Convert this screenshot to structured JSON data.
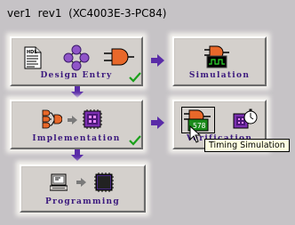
{
  "window": {
    "title": "ver1  rev1  (XC4003E-3-PC84)"
  },
  "flow": {
    "design_entry": {
      "label": "Design Entry",
      "completed": true
    },
    "simulation": {
      "label": "Simulation"
    },
    "implementation": {
      "label": "Implementation",
      "completed": true
    },
    "verification": {
      "label": "Verification"
    },
    "programming": {
      "label": "Programming"
    }
  },
  "tooltip": {
    "text": "Timing Simulation"
  },
  "icons": {
    "hdl_editor": "hdl-document-icon",
    "state_editor": "state-diagram-icon",
    "schematic": "and-gate-icon",
    "functional_sim": "logic-analyzer-icon",
    "impl_netlist": "netlist-tree-icon",
    "chip": "fpga-chip-icon",
    "timing_sim": "timing-simulation-icon",
    "timing_analyzer": "stopwatch-icon",
    "pc": "computer-icon",
    "prom": "prom-chip-icon"
  },
  "colors": {
    "accent": "#3c1a7e",
    "arrow": "#5a2ca8",
    "check": "#1aa01a"
  }
}
